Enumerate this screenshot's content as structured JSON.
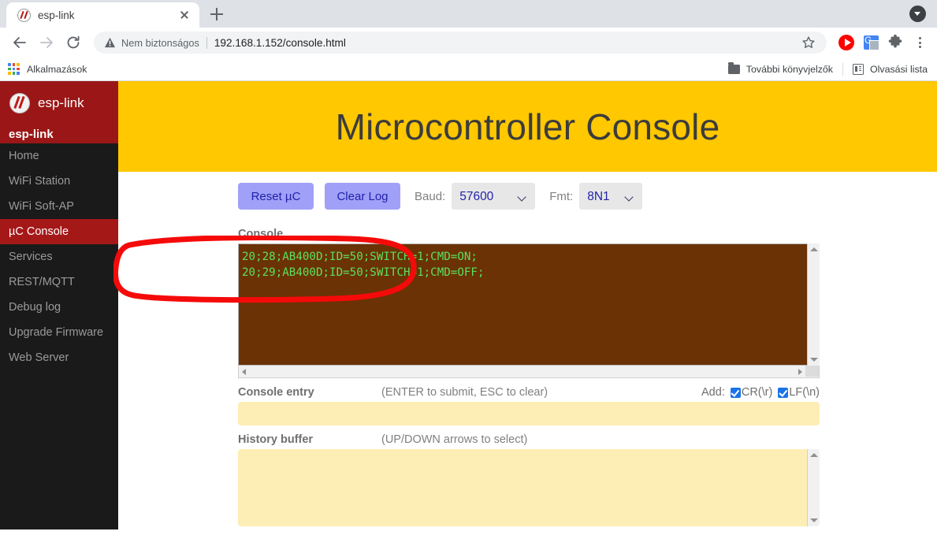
{
  "browser": {
    "tab": {
      "title": "esp-link",
      "favicon": "esp-link-favicon",
      "close_label": "×"
    },
    "new_tab_label": "+",
    "tab_search_label": "Tab search",
    "nav": {
      "back_label": "Back",
      "forward_label": "Forward",
      "reload_label": "Reload"
    },
    "omnibox": {
      "security_text": "Nem biztonságos",
      "url": "192.168.1.152/console.html",
      "star_label": "Bookmark this tab"
    },
    "toolbar_icons": [
      "youtube-icon",
      "google-translate-icon",
      "extensions-icon",
      "chrome-menu-icon"
    ],
    "bookmarks": {
      "apps_label": "Alkalmazások",
      "other_bookmarks_label": "További könyvjelzők",
      "reading_list_label": "Olvasási lista"
    }
  },
  "sidebar": {
    "logo_text": "esp-link",
    "brand": "esp-link",
    "items": [
      {
        "label": "Home",
        "active": false
      },
      {
        "label": "WiFi Station",
        "active": false
      },
      {
        "label": "WiFi Soft-AP",
        "active": false
      },
      {
        "label": "µC Console",
        "active": true
      },
      {
        "label": "Services",
        "active": false
      },
      {
        "label": "REST/MQTT",
        "active": false
      },
      {
        "label": "Debug log",
        "active": false
      },
      {
        "label": "Upgrade Firmware",
        "active": false
      },
      {
        "label": "Web Server",
        "active": false
      }
    ]
  },
  "page": {
    "banner_title": "Microcontroller Console",
    "toolbar": {
      "reset_label": "Reset µC",
      "clear_label": "Clear Log",
      "baud_label": "Baud:",
      "baud_value": "57600",
      "fmt_label": "Fmt:",
      "fmt_value": "8N1"
    },
    "console": {
      "label": "Console",
      "text": "20;28;AB400D;ID=50;SWITCH=1;CMD=ON;\n20;29;AB400D;ID=50;SWITCH=1;CMD=OFF;"
    },
    "entry": {
      "label": "Console entry",
      "hint": "(ENTER to submit, ESC to clear)",
      "add_label": "Add:",
      "cr_label": "CR(\\r)",
      "lf_label": "LF(\\n)",
      "cr_checked": true,
      "lf_checked": true,
      "value": "",
      "placeholder": ""
    },
    "history": {
      "label": "History buffer",
      "hint": "(UP/DOWN arrows to select)",
      "value": ""
    }
  },
  "annotation": {
    "type": "hand-drawn-ellipse",
    "color": "#f50a0a",
    "description": "Red ellipse highlighting the two console log lines"
  },
  "colors": {
    "banner": "#ffc800",
    "sidebar_bg": "#1a1a1a",
    "sidebar_accent": "#9b1616",
    "sidebar_active": "#a51818",
    "console_bg": "#6b3206",
    "console_text": "#5ce05c",
    "field_bg": "#fdeeb5",
    "button_bg": "#a0a0f8",
    "button_text": "#2222aa",
    "annotation": "#f50a0a"
  }
}
